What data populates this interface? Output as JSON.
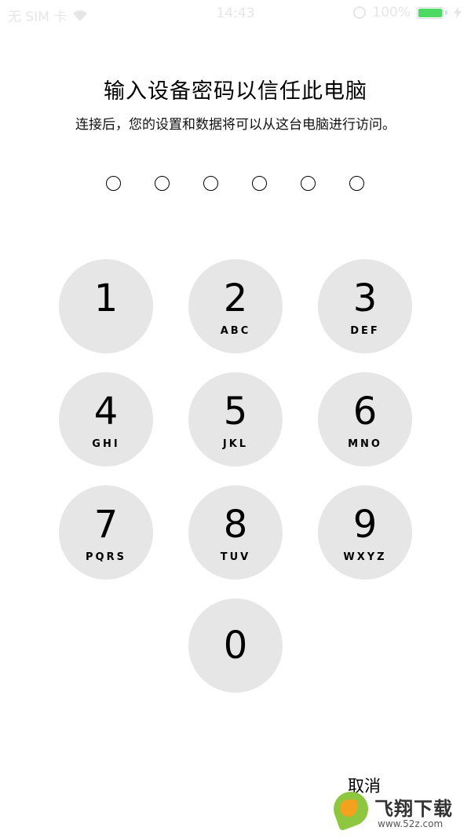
{
  "status_bar": {
    "carrier": "无 SIM 卡",
    "time": "14:43",
    "battery": "100%",
    "battery_level": 1.0
  },
  "header": {
    "title": "输入设备密码以信任此电脑",
    "subtitle": "连接后，您的设置和数据将可以从这台电脑进行访问。"
  },
  "passcode": {
    "length": 6,
    "entered": 0
  },
  "keypad": {
    "keys": [
      {
        "digit": "1",
        "letters": ""
      },
      {
        "digit": "2",
        "letters": "ABC"
      },
      {
        "digit": "3",
        "letters": "DEF"
      },
      {
        "digit": "4",
        "letters": "GHI"
      },
      {
        "digit": "5",
        "letters": "JKL"
      },
      {
        "digit": "6",
        "letters": "MNO"
      },
      {
        "digit": "7",
        "letters": "PQRS"
      },
      {
        "digit": "8",
        "letters": "TUV"
      },
      {
        "digit": "9",
        "letters": "WXYZ"
      },
      {
        "digit": "0",
        "letters": ""
      }
    ],
    "key_color": "#e6e6e6"
  },
  "cancel_label": "取消",
  "watermark": {
    "name": "飞翔下载",
    "url": "www.52z.com"
  }
}
